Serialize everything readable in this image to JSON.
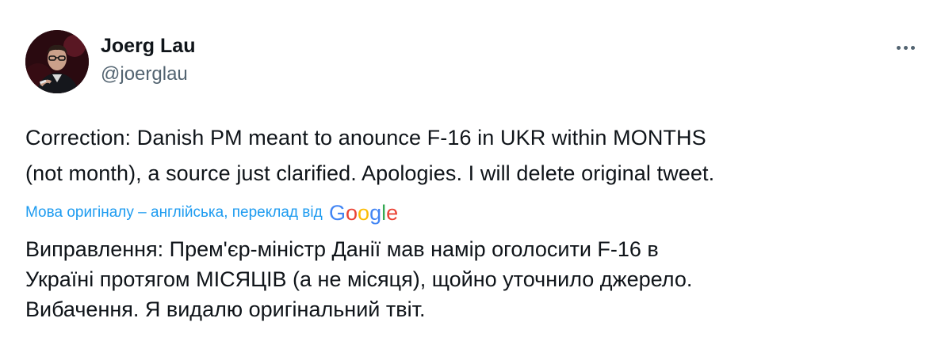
{
  "tweet": {
    "author": {
      "display_name": "Joerg Lau",
      "handle": "@joerglau"
    },
    "more_icon": "more-horizontal-icon",
    "text_lines": [
      "Correction: Danish PM meant to anounce F-16 in UKR within MONTHS",
      "(not month), a source just clarified. Apologies. I will delete original tweet."
    ],
    "translation": {
      "source_label": "Мова оригіналу – англійська, переклад від",
      "provider": "Google",
      "provider_colors": [
        "#4285F4",
        "#EA4335",
        "#FBBC05",
        "#4285F4",
        "#34A853",
        "#EA4335"
      ],
      "text_lines": [
        "Виправлення: Прем'єр-міністр Данії мав намір оголосити F-16 в",
        "Україні протягом МІСЯЦІВ (а не місяця), щойно уточнило джерело.",
        "Вибачення. Я видалю оригінальний твіт."
      ]
    },
    "colors": {
      "text": "#0f1419",
      "secondary": "#536471",
      "link": "#1d9bf0"
    }
  }
}
